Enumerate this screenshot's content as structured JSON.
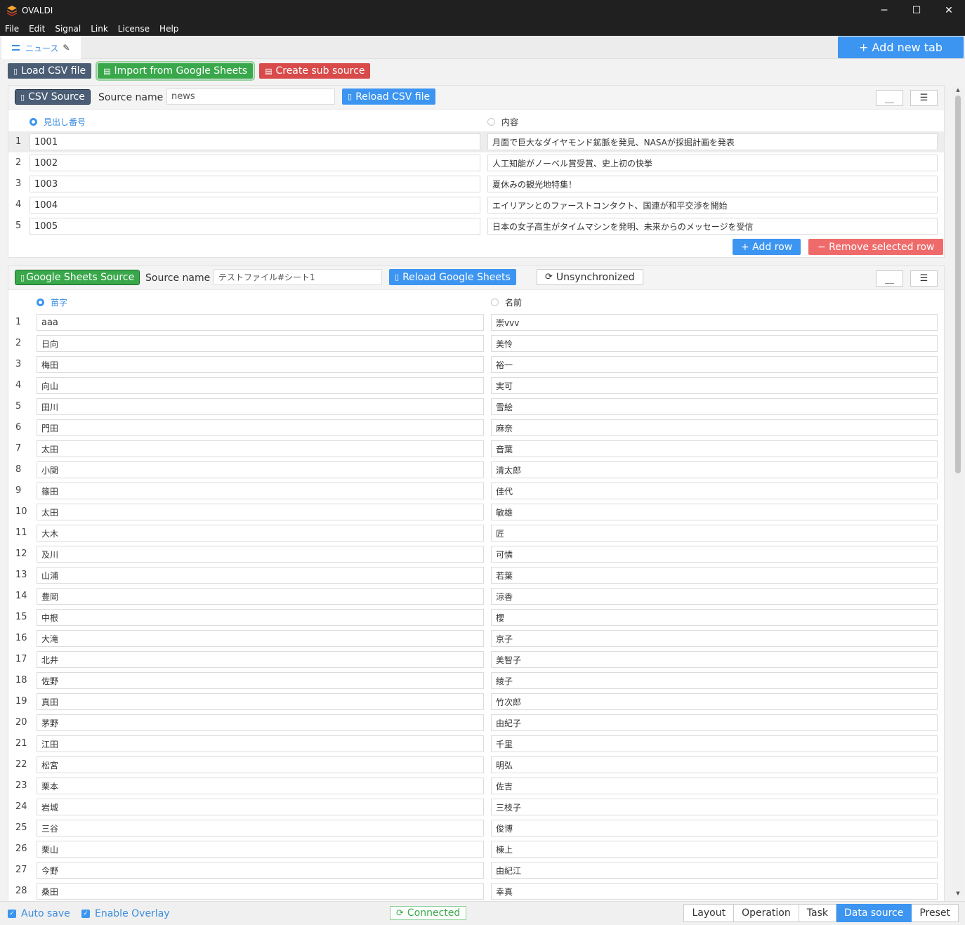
{
  "app": {
    "title": "OVALDI",
    "menu": [
      "File",
      "Edit",
      "Signal",
      "Link",
      "License",
      "Help"
    ]
  },
  "tabs": {
    "current": "ニュース",
    "add_label": "+ Add new tab"
  },
  "toolbar": {
    "load_csv": "Load CSV file",
    "import_gs": "Import from Google Sheets",
    "create_sub": "Create sub source"
  },
  "csv": {
    "badge": "CSV Source",
    "source_label": "Source name",
    "source_value": "news",
    "reload": "Reload CSV file",
    "col1": "見出し番号",
    "col2": "内容",
    "rows": [
      [
        "1001",
        "月面で巨大なダイヤモンド鉱脈を発見、NASAが採掘計画を発表"
      ],
      [
        "1002",
        "人工知能がノーベル賞受賞、史上初の快挙"
      ],
      [
        "1003",
        "夏休みの観光地特集！"
      ],
      [
        "1004",
        "エイリアンとのファーストコンタクト、国連が和平交渉を開始"
      ],
      [
        "1005",
        "日本の女子高生がタイムマシンを発明、未来からのメッセージを受信"
      ]
    ],
    "add_row": "+ Add row",
    "remove_row": "− Remove selected row"
  },
  "gs": {
    "badge": "Google Sheets Source",
    "source_label": "Source name",
    "source_value": "テストファイル#シート1",
    "reload": "Reload Google Sheets",
    "sync": "Unsynchronized",
    "col1": "苗字",
    "col2": "名前",
    "rows": [
      [
        "aaa",
        "崇vvv"
      ],
      [
        "日向",
        "美怜"
      ],
      [
        "梅田",
        "裕一"
      ],
      [
        "向山",
        "実可"
      ],
      [
        "田川",
        "雪絵"
      ],
      [
        "門田",
        "麻奈"
      ],
      [
        "太田",
        "音葉"
      ],
      [
        "小関",
        "清太郎"
      ],
      [
        "篠田",
        "佳代"
      ],
      [
        "太田",
        "敏雄"
      ],
      [
        "大木",
        "匠"
      ],
      [
        "及川",
        "可憐"
      ],
      [
        "山浦",
        "若葉"
      ],
      [
        "豊岡",
        "涼香"
      ],
      [
        "中根",
        "櫻"
      ],
      [
        "大滝",
        "京子"
      ],
      [
        "北井",
        "美智子"
      ],
      [
        "佐野",
        "綾子"
      ],
      [
        "真田",
        "竹次郎"
      ],
      [
        "茅野",
        "由紀子"
      ],
      [
        "江田",
        "千里"
      ],
      [
        "松宮",
        "明弘"
      ],
      [
        "栗本",
        "佐吉"
      ],
      [
        "岩城",
        "三枝子"
      ],
      [
        "三谷",
        "俊博"
      ],
      [
        "栗山",
        "棟上"
      ],
      [
        "今野",
        "由紀江"
      ],
      [
        "桑田",
        "幸真"
      ]
    ]
  },
  "status": {
    "autosave": "Auto save",
    "overlay": "Enable Overlay",
    "connected": "Connected",
    "nav": [
      "Layout",
      "Operation",
      "Task",
      "Data source",
      "Preset"
    ],
    "active_nav": "Data source"
  }
}
